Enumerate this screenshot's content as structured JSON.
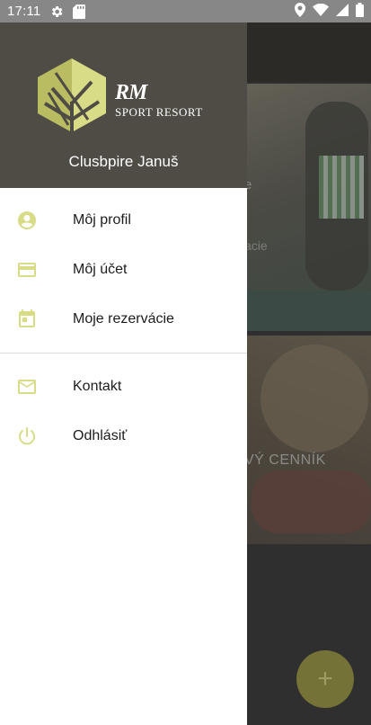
{
  "status_bar": {
    "time": "17:11",
    "left_icons": [
      "gear-icon",
      "sd-card-icon"
    ],
    "right_icons": [
      "location-icon",
      "wifi-icon",
      "signal-icon",
      "battery-icon"
    ]
  },
  "drawer": {
    "logo": {
      "brand_line1": "RM",
      "brand_line2": "SPORT RESORT"
    },
    "user_name": "Clusbpire Januš",
    "menu": [
      {
        "label": "Môj profil",
        "icon": "account-circle-icon"
      },
      {
        "label": "Môj účet",
        "icon": "credit-card-icon"
      },
      {
        "label": "Moje rezervácie",
        "icon": "calendar-icon"
      }
    ],
    "secondary_menu": [
      {
        "label": "Kontakt",
        "icon": "mail-icon"
      },
      {
        "label": "Odhlásiť",
        "icon": "power-icon"
      }
    ]
  },
  "background": {
    "card1_fragment_1": "e",
    "card1_fragment_2": "acie",
    "card2_fragment": "VÝ CENNÍK",
    "fab_symbol": "+"
  },
  "colors": {
    "accent": "#d9dc86",
    "header_bg": "#4f4b45",
    "status_bar": "#878787"
  }
}
